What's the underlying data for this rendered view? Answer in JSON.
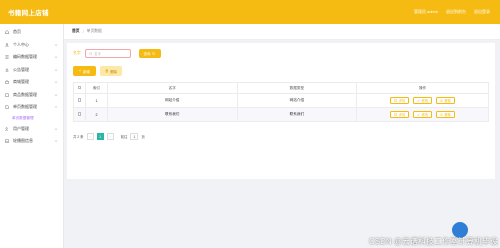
{
  "header": {
    "brand": "书籍网上店铺",
    "user_text": "管理员 admin",
    "front_link": "退出到前台",
    "logout_link": "退出登录"
  },
  "sidebar": {
    "items": [
      {
        "label": "首页",
        "icon": "home-icon",
        "arrow": false
      },
      {
        "label": "个人中心",
        "icon": "user-icon",
        "arrow": true
      },
      {
        "label": "编码数据管理",
        "icon": "list-icon",
        "arrow": true
      },
      {
        "label": "公告管理",
        "icon": "bell-icon",
        "arrow": true
      },
      {
        "label": "商城管理",
        "icon": "shop-icon",
        "arrow": true
      },
      {
        "label": "商品数据管理",
        "icon": "box-icon",
        "arrow": true
      },
      {
        "label": "单页数据管理",
        "icon": "page-icon",
        "arrow": true
      }
    ],
    "sub_item": "单页数据管理",
    "items_after": [
      {
        "label": "用户管理",
        "icon": "users-icon",
        "arrow": true
      },
      {
        "label": "轮播图信息",
        "icon": "image-icon",
        "arrow": true
      }
    ]
  },
  "breadcrumb": {
    "home": "首页",
    "current": "单页数据"
  },
  "search": {
    "label": "名字",
    "placeholder": "名字",
    "button": "查询"
  },
  "actions": {
    "add": "新增",
    "delete": "删除"
  },
  "table": {
    "headers": [
      "索引",
      "名字",
      "数据类型",
      "操作"
    ],
    "rows": [
      {
        "index": "1",
        "name": "网站介绍",
        "type": "网站介绍"
      },
      {
        "index": "2",
        "name": "联系我们",
        "type": "联系我们"
      }
    ],
    "ops": {
      "detail": "详情",
      "edit": "修改",
      "delete": "删除"
    }
  },
  "pager": {
    "total": "共 2 条",
    "current": "1",
    "goto_label": "前往",
    "goto_value": "1",
    "page_suffix": "页"
  },
  "watermark": "CSDN @云谱科技工作室计算机毕设",
  "colors": {
    "primary": "#f6bb12",
    "accent": "#29b6a6",
    "sub": "#b26cf4"
  }
}
